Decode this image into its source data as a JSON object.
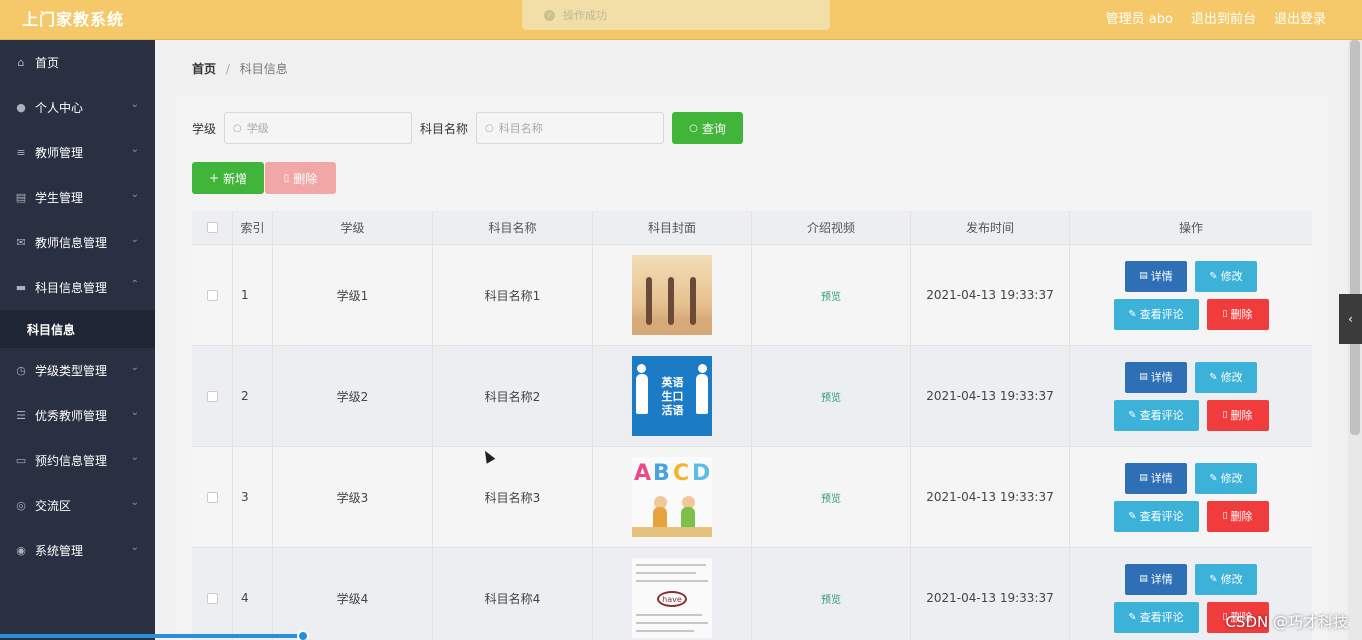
{
  "app": {
    "title": "上门家教系统"
  },
  "header": {
    "user_label": "管理员 abo",
    "front_label": "退出到前台",
    "logout_label": "退出登录"
  },
  "toast": {
    "message": "操作成功"
  },
  "sidebar": {
    "items": [
      {
        "label": "首页",
        "icon": "home-icon"
      },
      {
        "label": "个人中心",
        "icon": "user-icon"
      },
      {
        "label": "教师管理",
        "icon": "list-icon"
      },
      {
        "label": "学生管理",
        "icon": "chart-icon"
      },
      {
        "label": "教师信息管理",
        "icon": "mail-icon"
      },
      {
        "label": "科目信息管理",
        "icon": "chat-icon"
      },
      {
        "label": "学级类型管理",
        "icon": "clock-icon"
      },
      {
        "label": "优秀教师管理",
        "icon": "sliders-icon"
      },
      {
        "label": "预约信息管理",
        "icon": "message-icon"
      },
      {
        "label": "交流区",
        "icon": "compass-icon"
      },
      {
        "label": "系统管理",
        "icon": "location-icon"
      }
    ],
    "sub_item": "科目信息"
  },
  "breadcrumb": {
    "home": "首页",
    "separator": "/",
    "current": "科目信息"
  },
  "search": {
    "grade_label": "学级",
    "grade_placeholder": "学级",
    "name_label": "科目名称",
    "name_placeholder": "科目名称",
    "query_label": "查询"
  },
  "toolbar": {
    "add_label": "新增",
    "delete_label": "删除"
  },
  "table": {
    "headers": [
      "索引",
      "学级",
      "科目名称",
      "科目封面",
      "介绍视频",
      "发布时间",
      "操作"
    ],
    "rows": [
      {
        "index": "1",
        "grade": "学级1",
        "name": "科目名称1",
        "video": "预览",
        "time": "2021-04-13 19:33:37",
        "cover_text": ""
      },
      {
        "index": "2",
        "grade": "学级2",
        "name": "科目名称2",
        "video": "预览",
        "time": "2021-04-13 19:33:37",
        "cover_text": "英语 生口 活语"
      },
      {
        "index": "3",
        "grade": "学级3",
        "name": "科目名称3",
        "video": "预览",
        "time": "2021-04-13 19:33:37",
        "cover_text": "ABCD"
      },
      {
        "index": "4",
        "grade": "学级4",
        "name": "科目名称4",
        "video": "预览",
        "time": "2021-04-13 19:33:37",
        "cover_text": "have"
      }
    ],
    "ops": {
      "detail": "详情",
      "edit": "修改",
      "comment": "查看评论",
      "delete": "删除"
    }
  },
  "watermark": "CSDN @巧才科技",
  "colors": {
    "topbar": "#f5c96a",
    "sidebar": "#283042",
    "success": "#40b53a",
    "danger": "#f03c3c",
    "info": "#3db2d8",
    "primary": "#2e6fb6"
  }
}
